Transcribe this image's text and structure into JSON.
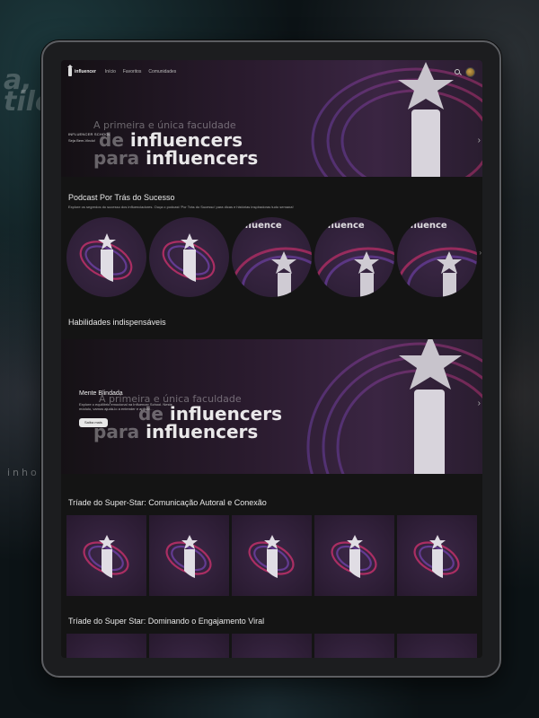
{
  "background": {
    "text1": "a, s\ntilo",
    "text2": "",
    "text3": "",
    "text4": "inho"
  },
  "nav": {
    "logo_text": "influencer",
    "links": [
      "Início",
      "Favoritos",
      "Comunidades"
    ]
  },
  "hero": {
    "tag": "INFLUENCER SCHOOL",
    "welcome": "Seja Bem-Vindo!",
    "brand_line1": "A primeira e única faculdade",
    "brand_line2_prefix": "de ",
    "brand_line2_bold": "influencers",
    "brand_line3_prefix": "para ",
    "brand_line3_bold": "influencers"
  },
  "podcast": {
    "title": "Podcast Por Trás do Sucesso",
    "description": "Explore os segredos do sucesso dos influenciadores. Ouça o podcast 'Por Trás do Sucesso' para dicas e histórias inspiradoras tudo semana!",
    "circle_text": "influence"
  },
  "skills": {
    "title": "Habilidades indispensáveis"
  },
  "banner": {
    "title": "Mente Blindada",
    "description": "Explore o equilíbrio emocional na Influencer School. Neste módulo, vamos ajudá-lo a entender e aplicar…",
    "button": "Saiba mais",
    "brand_line1": "A primeira e única faculdade",
    "brand_line2_prefix": "de ",
    "brand_line2_bold": "influencers",
    "brand_line3_prefix": "para ",
    "brand_line3_bold": "influencers"
  },
  "triade1": {
    "title": "Tríade do Super-Star: Comunicação Autoral e Conexão"
  },
  "triade2": {
    "title": "Tríade do Super Star: Dominando o Engajamento Viral"
  },
  "colors": {
    "accent_pink": "#c0306a",
    "accent_purple": "#6b3fa0",
    "tile_bg": "#33223d"
  }
}
